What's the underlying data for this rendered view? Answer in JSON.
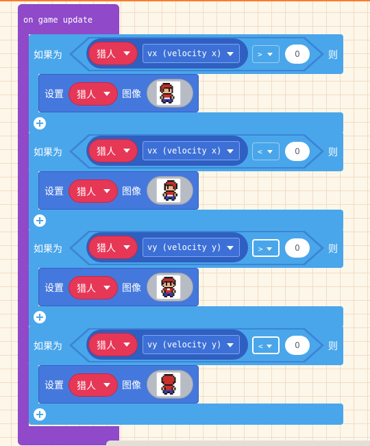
{
  "event_block": {
    "label": "on game update"
  },
  "if_blocks": [
    {
      "if_label": "如果为",
      "then_label": "则",
      "sprite": "猎人",
      "property": "vx (velocity x)",
      "operator": ">",
      "value": "0",
      "operator_highlighted": false,
      "set_block": {
        "set_label": "设置",
        "sprite": "猎人",
        "image_label": "图像",
        "image": "hunter-facing-right-sprite"
      }
    },
    {
      "if_label": "如果为",
      "then_label": "则",
      "sprite": "猎人",
      "property": "vx (velocity x)",
      "operator": "<",
      "value": "0",
      "operator_highlighted": false,
      "set_block": {
        "set_label": "设置",
        "sprite": "猎人",
        "image_label": "图像",
        "image": "hunter-facing-left-sprite"
      }
    },
    {
      "if_label": "如果为",
      "then_label": "则",
      "sprite": "猎人",
      "property": "vy (velocity y)",
      "operator": ">",
      "value": "0",
      "operator_highlighted": true,
      "set_block": {
        "set_label": "设置",
        "sprite": "猎人",
        "image_label": "图像",
        "image": "hunter-facing-down-sprite"
      }
    },
    {
      "if_label": "如果为",
      "then_label": "则",
      "sprite": "猎人",
      "property": "vy (velocity y)",
      "operator": "<",
      "value": "0",
      "operator_highlighted": true,
      "set_block": {
        "set_label": "设置",
        "sprite": "猎人",
        "image_label": "图像",
        "image": "hunter-facing-up-sprite"
      }
    }
  ],
  "colors": {
    "event": "#8f49c9",
    "logic": "#4aa6ea",
    "sprites": "#4578dd",
    "sprite_var": "#e63757",
    "workspace": "#fdf7ea"
  }
}
